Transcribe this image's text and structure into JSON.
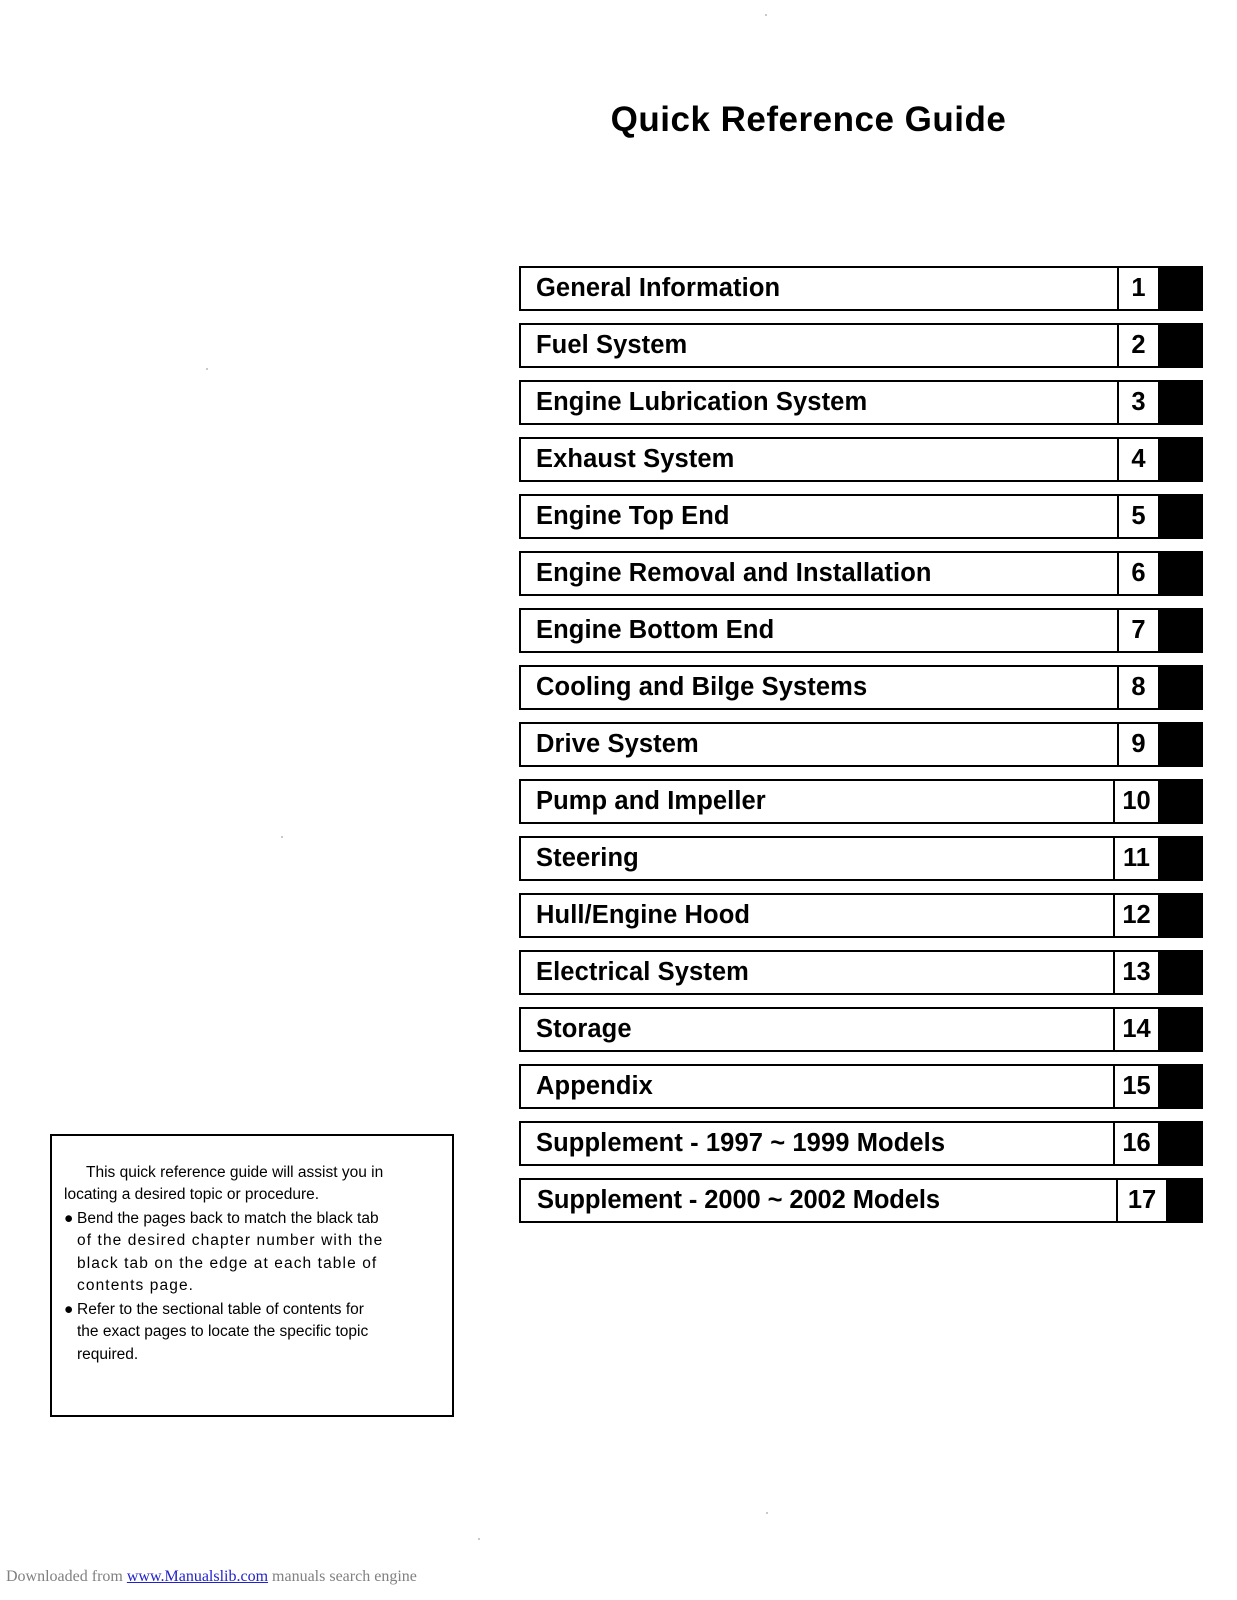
{
  "page": {
    "title": "Quick Reference Guide"
  },
  "chapter_index": {
    "rows": [
      {
        "title": "General Information",
        "number": "1"
      },
      {
        "title": "Fuel System",
        "number": "2"
      },
      {
        "title": "Engine Lubrication System",
        "number": "3"
      },
      {
        "title": "Exhaust System",
        "number": "4"
      },
      {
        "title": "Engine Top End",
        "number": "5"
      },
      {
        "title": "Engine Removal and Installation",
        "number": "6"
      },
      {
        "title": "Engine Bottom End",
        "number": "7"
      },
      {
        "title": "Cooling and Bilge Systems",
        "number": "8"
      },
      {
        "title": "Drive System",
        "number": "9"
      },
      {
        "title": "Pump and Impeller",
        "number": "10"
      },
      {
        "title": "Steering",
        "number": "11"
      },
      {
        "title": "Hull/Engine Hood",
        "number": "12"
      },
      {
        "title": "Electrical System",
        "number": "13"
      },
      {
        "title": "Storage",
        "number": "14"
      },
      {
        "title": "Appendix",
        "number": "15"
      },
      {
        "title": "Supplement - 1997 ~ 1999 Models",
        "number": "16"
      },
      {
        "title": "Supplement - 2000  ~  2002 Models",
        "number": "17"
      }
    ]
  },
  "note_box": {
    "intro": "This quick reference guide will assist you in locating a desired topic or procedure.",
    "bullet_marker": "●",
    "bullets": [
      {
        "line1": "Bend the pages back to match the black tab",
        "line2": "of the desired chapter number with the",
        "line3": "black tab on the edge at each table of",
        "line4": "contents page."
      },
      {
        "line1": "Refer to the sectional table of contents for",
        "line2": "the exact pages to locate the specific topic",
        "line3": "required.",
        "line4": ""
      }
    ]
  },
  "footer": {
    "prefix": "Downloaded from ",
    "link": "www.Manualslib.com",
    "suffix": " manuals search engine"
  },
  "colors": {
    "ink": "#000000",
    "tab": "#000000",
    "paper": "#ffffff",
    "footer_text": "#808080",
    "footer_link": "#2222cc"
  }
}
